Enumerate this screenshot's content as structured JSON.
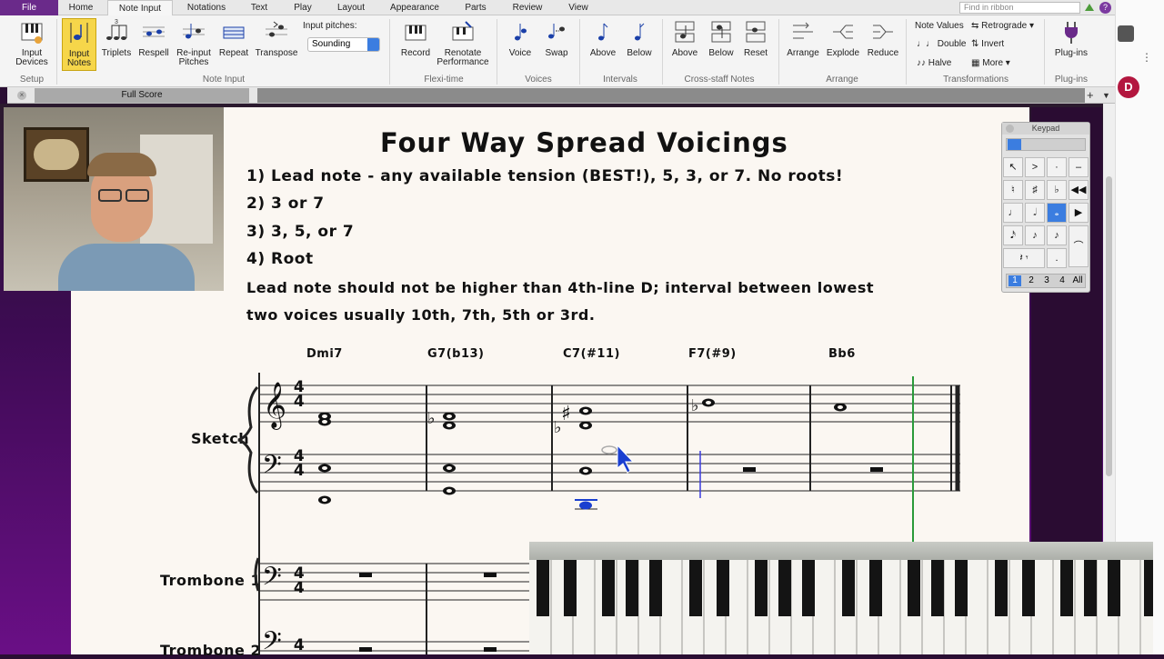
{
  "tabs": [
    "File",
    "Home",
    "Note Input",
    "Notations",
    "Text",
    "Play",
    "Layout",
    "Appearance",
    "Parts",
    "Review",
    "View"
  ],
  "find_placeholder": "Find in ribbon",
  "ribbon": {
    "input_devices": "Input Devices",
    "input_notes": "Input Notes",
    "triplets": "Triplets",
    "respell": "Respell",
    "reinput": "Re-input Pitches",
    "repeat": "Repeat",
    "transpose": "Transpose",
    "input_pitches_label": "Input pitches:",
    "input_pitches_value": "Sounding",
    "record": "Record",
    "renotate": "Renotate Performance",
    "voice": "Voice",
    "swap": "Swap",
    "above": "Above",
    "below": "Below",
    "cs_above": "Above",
    "cs_below": "Below",
    "cs_reset": "Reset",
    "arrange": "Arrange",
    "explode": "Explode",
    "reduce": "Reduce",
    "note_values": "Note Values",
    "double": "Double",
    "halve": "Halve",
    "retrograde": "Retrograde",
    "invert": "Invert",
    "more": "More",
    "plugins": "Plug-ins",
    "groups": {
      "setup": "Setup",
      "note_input": "Note Input",
      "flexi": "Flexi-time",
      "voices": "Voices",
      "intervals": "Intervals",
      "cross": "Cross-staff Notes",
      "arrange": "Arrange",
      "transformations": "Transformations",
      "plugins": "Plug-ins"
    }
  },
  "doc_tab": "Full Score",
  "avatar_letter": "D",
  "score": {
    "title": "Four Way Spread Voicings",
    "lines": [
      "1) Lead note - any available tension (BEST!), 5, 3, or 7. No roots!",
      "2) 3 or 7",
      "3) 3, 5, or 7",
      "4) Root",
      "Lead note should not be higher than 4th-line D; interval between lowest",
      "two voices usually 10th, 7th, 5th or 3rd."
    ],
    "chords": [
      "Dmi7",
      "G7(b13)",
      "C7(#11)",
      "F7(#9)",
      "Bb6"
    ],
    "time_sig_top": "4",
    "time_sig_bottom": "4",
    "staves": [
      "Sketch",
      "Trombone 1",
      "Trombone 2"
    ]
  },
  "keypad": {
    "title": "Keypad",
    "tabs": [
      "1",
      "2",
      "3",
      "4",
      "All"
    ]
  }
}
